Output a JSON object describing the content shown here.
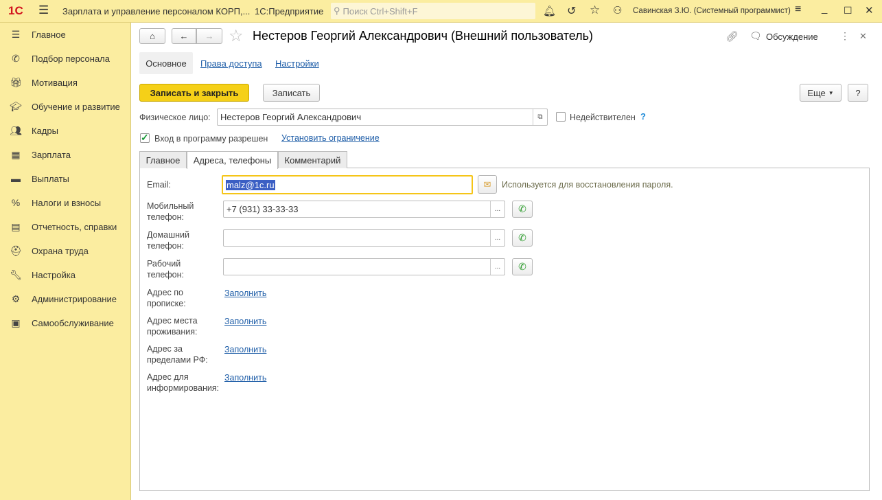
{
  "topbar": {
    "logo": "1С",
    "app_title": "Зарплата и управление персоналом КОРП,...",
    "platform": "1С:Предприятие",
    "search_placeholder": "Поиск Ctrl+Shift+F",
    "user": "Савинская З.Ю. (Системный программист)"
  },
  "sidebar": {
    "items": [
      {
        "label": "Главное",
        "icon": "menu-icon"
      },
      {
        "label": "Подбор персонала",
        "icon": "phone-icon"
      },
      {
        "label": "Мотивация",
        "icon": "gift-icon"
      },
      {
        "label": "Обучение и развитие",
        "icon": "graduation-icon"
      },
      {
        "label": "Кадры",
        "icon": "people-icon"
      },
      {
        "label": "Зарплата",
        "icon": "calculator-icon"
      },
      {
        "label": "Выплаты",
        "icon": "wallet-icon"
      },
      {
        "label": "Налоги и взносы",
        "icon": "percent-icon"
      },
      {
        "label": "Отчетность, справки",
        "icon": "report-icon"
      },
      {
        "label": "Охрана труда",
        "icon": "helmet-icon"
      },
      {
        "label": "Настройка",
        "icon": "wrench-icon"
      },
      {
        "label": "Администрирование",
        "icon": "gear-icon"
      },
      {
        "label": "Самообслуживание",
        "icon": "id-card-icon"
      }
    ]
  },
  "form": {
    "title": "Нестеров Георгий Александрович (Внешний пользователь)",
    "discussion": "Обсуждение",
    "nav_tabs": [
      "Основное",
      "Права доступа",
      "Настройки"
    ],
    "save_close": "Записать и закрыть",
    "save": "Записать",
    "more": "Еще",
    "help": "?",
    "person_label": "Физическое лицо:",
    "person_value": "Нестеров Георгий Александрович",
    "invalid_label": "Недействителен",
    "invalid_help": "?",
    "login_allowed": "Вход в программу разрешен",
    "set_restriction": "Установить ограничение",
    "tabs": [
      "Главное",
      "Адреса, телефоны",
      "Комментарий"
    ],
    "email_label": "Email:",
    "email_value": "malz@1c.ru",
    "email_hint": "Используется для восстановления пароля.",
    "phones": [
      {
        "label1": "Мобильный",
        "label2": "телефон:",
        "value": "+7 (931) 33-33-33"
      },
      {
        "label1": "Домашний",
        "label2": "телефон:",
        "value": ""
      },
      {
        "label1": "Рабочий",
        "label2": "телефон:",
        "value": ""
      }
    ],
    "addresses": [
      {
        "label1": "Адрес по",
        "label2": "прописке:",
        "link": "Заполнить"
      },
      {
        "label1": "Адрес места",
        "label2": "проживания:",
        "link": "Заполнить"
      },
      {
        "label1": "Адрес за",
        "label2": "пределами РФ:",
        "link": "Заполнить"
      },
      {
        "label1": "Адрес для",
        "label2": "информирования:",
        "link": "Заполнить"
      }
    ]
  },
  "colors": {
    "accent": "#f5d018",
    "logo": "#d2141e",
    "link": "#1f5ea8",
    "selection": "#3b5fc4"
  }
}
